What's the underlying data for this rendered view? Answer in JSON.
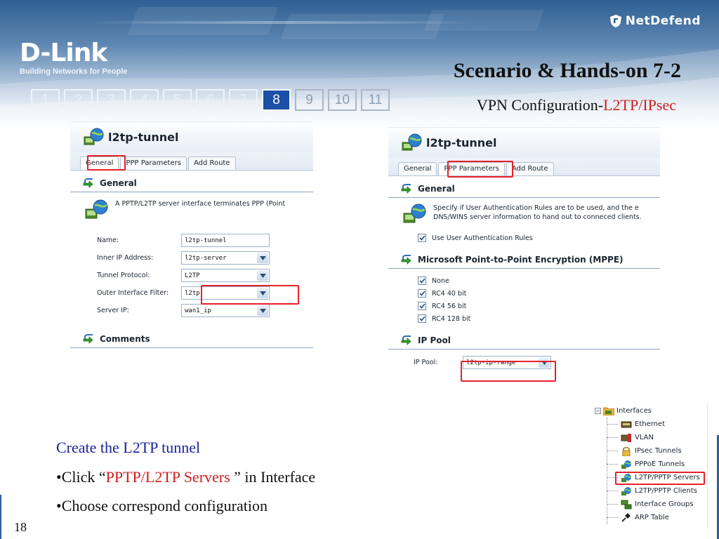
{
  "slide": {
    "brand": {
      "name": "D-Link",
      "tagline": "Building Networks for People",
      "product": "NetDefend"
    },
    "title": "Scenario & Hands-on 7-2",
    "subtitle_prefix": "VPN Configuration-",
    "subtitle_highlight": "L2TP/IPsec",
    "pager": {
      "pages": [
        "1",
        "2",
        "3",
        "4",
        "5",
        "6",
        "7",
        "8",
        "9",
        "10",
        "11"
      ],
      "current": "8"
    },
    "page_number": "18"
  },
  "left_screenshot": {
    "title": "l2tp-tunnel",
    "tabs": [
      "General",
      "PPP Parameters",
      "Add Route"
    ],
    "selected_tab": "General",
    "section_general": "General",
    "description": "A PPTP/L2TP server interface terminates PPP (Point",
    "fields": [
      {
        "label": "Name:",
        "value": "l2tp-tunnel",
        "type": "text"
      },
      {
        "label": "Inner IP Address:",
        "value": "l2tp-server",
        "type": "select"
      },
      {
        "label": "Tunnel Protocol:",
        "value": "L2TP",
        "type": "select"
      },
      {
        "label": "Outer Interface Filter:",
        "value": "l2tp",
        "type": "select"
      },
      {
        "label": "Server IP:",
        "value": "wan1_ip",
        "type": "select"
      }
    ],
    "section_comments": "Comments"
  },
  "right_screenshot": {
    "title": "l2tp-tunnel",
    "tabs": [
      "General",
      "PPP Parameters",
      "Add Route"
    ],
    "selected_tab": "PPP Parameters",
    "section_general": "General",
    "description_line1": "Specify if User Authentication Rules are to be used, and the e",
    "description_line2": "DNS/WINS server information to hand out to conneced clients.",
    "use_auth_rules": "Use User Authentication Rules",
    "section_mppe": "Microsoft Point-to-Point Encryption (MPPE)",
    "mppe_options": [
      "None",
      "RC4 40 bit",
      "RC4 56 bit",
      "RC4 128 bit"
    ],
    "section_ippool": "IP Pool",
    "ip_pool_label": "IP Pool:",
    "ip_pool_value": "l2tp-ip-range"
  },
  "tree": {
    "root": "Interfaces",
    "items": [
      "Ethernet",
      "VLAN",
      "IPsec Tunnels",
      "PPPoE Tunnels",
      "L2TP/PPTP Servers",
      "L2TP/PPTP Clients",
      "Interface Groups",
      "ARP Table"
    ],
    "highlighted": "L2TP/PPTP Servers"
  },
  "instructions": {
    "heading": "Create the L2TP tunnel",
    "step1_prefix": "•Click “",
    "step1_highlight": "PPTP/L2TP Servers",
    "step1_suffix": " ” in Interface",
    "step2": "•Choose correspond configuration"
  },
  "colors": {
    "highlight_red": "#e8202a",
    "text_red": "#cc1f1f",
    "heading_blue": "#1a1f9a",
    "pager_active": "#1c4fa6",
    "banner": "#2f5f93"
  },
  "icons": {
    "tunnel": "globe-computer-icon",
    "section": "arrow-right-icon",
    "dropdown": "chevron-down-icon",
    "checkbox": "check-icon",
    "folder": "folder-icon"
  }
}
